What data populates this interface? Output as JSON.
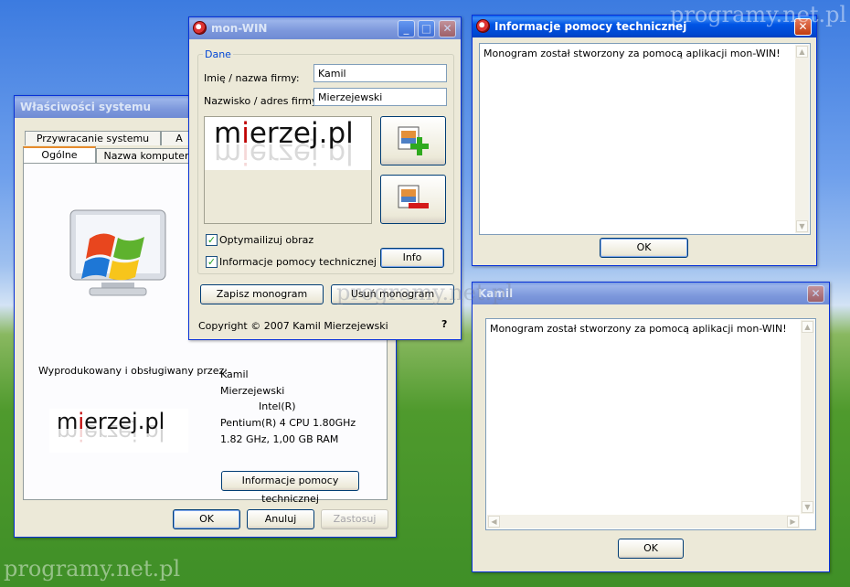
{
  "system_props": {
    "title": "Właściwości systemu",
    "tabs_row1": [
      "Przywracanie systemu",
      "A"
    ],
    "tabs_row2": [
      "Ogólne",
      "Nazwa komputer"
    ],
    "manufacturer_label": "Wyprodukowany i obsługiwany przez:",
    "info_lines": [
      "Kamil",
      "Mierzejewski",
      "Intel(R)",
      "Pentium(R) 4 CPU 1.80GHz",
      "1.82 GHz, 1,00 GB RAM"
    ],
    "support_button": "Informacje pomocy technicznej",
    "ok": "OK",
    "cancel": "Anuluj",
    "apply": "Zastosuj",
    "logo": {
      "pre": "m",
      "i": "i",
      "post": "erzej.pl"
    }
  },
  "monwin": {
    "title": "mon-WIN",
    "group": "Dane",
    "name_label": "Imię / nazwa firmy:",
    "name_value": "Kamil",
    "surname_label": "Nazwisko / adres firmy:",
    "surname_value": "Mierzejewski",
    "logo": {
      "pre": "m",
      "i": "i",
      "post": "erzej.pl"
    },
    "optimize_label": "Optymailizuj obraz",
    "optimize_checked": true,
    "support_label": "Informacje pomocy technicznej",
    "support_checked": true,
    "info_button": "Info",
    "save_button": "Zapisz monogram",
    "remove_button": "Usuń monogram",
    "copyright": "Copyright © 2007 Kamil Mierzejewski",
    "help": "?"
  },
  "info_window": {
    "title": "Informacje pomocy technicznej",
    "text": "Monogram został stworzony za pomocą aplikacji mon-WIN!",
    "ok": "OK"
  },
  "kamil_window": {
    "title": "Kamil",
    "text": "Monogram został stworzony za pomocą aplikacji mon-WIN!",
    "ok": "OK"
  },
  "watermark": "programy.net.pl",
  "colors": {
    "title_active": "#0055e5",
    "title_inactive": "#7d98dc",
    "window_bg": "#ece9d8",
    "accent_red": "#c00000"
  }
}
